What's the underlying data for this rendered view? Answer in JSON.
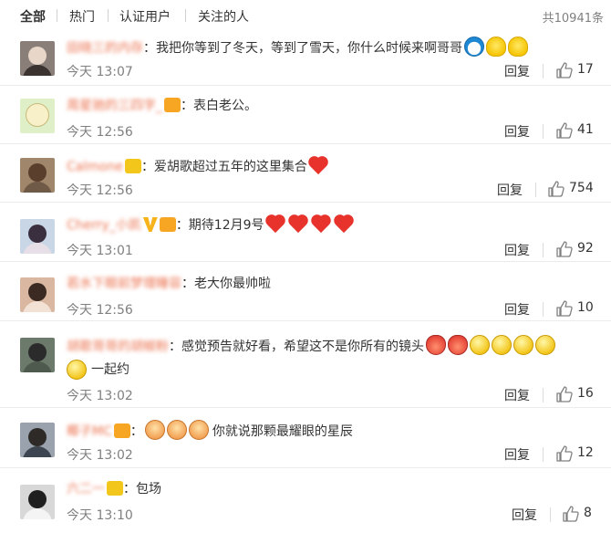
{
  "filter_bar": {
    "tabs": [
      "全部",
      "热门",
      "认证用户",
      "关注的人"
    ],
    "total": "共10941条"
  },
  "comments": [
    {
      "name": "田晓三的内存",
      "text": "：我把你等到了冬天，等到了雪天，你什么时候来啊哥哥",
      "time": "今天 13:07",
      "reply": "回复",
      "likes": "17"
    },
    {
      "name": "周星驰的三四字_",
      "text": "：表白老公。",
      "time": "今天 12:56",
      "reply": "回复",
      "likes": "41"
    },
    {
      "name": "Calmone",
      "text": "：爱胡歌超过五年的这里集合",
      "time": "今天 12:56",
      "reply": "回复",
      "likes": "754"
    },
    {
      "name": "Cherry_小凯",
      "text": "：期待12月9号",
      "time": "今天 13:01",
      "reply": "回复",
      "likes": "92"
    },
    {
      "name": "若水下眼前梦理睡容",
      "text": "：老大你最帅啦",
      "time": "今天 12:56",
      "reply": "回复",
      "likes": "10"
    },
    {
      "name": "胡歌哥哥的胡椒粉",
      "text": "：感觉预告就好看，希望这不是你所有的镜头",
      "text2": "一起约",
      "time": "今天 13:02",
      "reply": "回复",
      "likes": "16"
    },
    {
      "name": "椰子MC",
      "text": "你就说那颗最耀眼的星辰",
      "time": "今天 13:02",
      "reply": "回复",
      "likes": "12"
    },
    {
      "name": "六二一",
      "text": "：包场",
      "time": "今天 13:10",
      "reply": "回复",
      "likes": "8"
    }
  ],
  "colors": {
    "username": "#eb7350",
    "meta": "#808080",
    "text": "#333333"
  }
}
